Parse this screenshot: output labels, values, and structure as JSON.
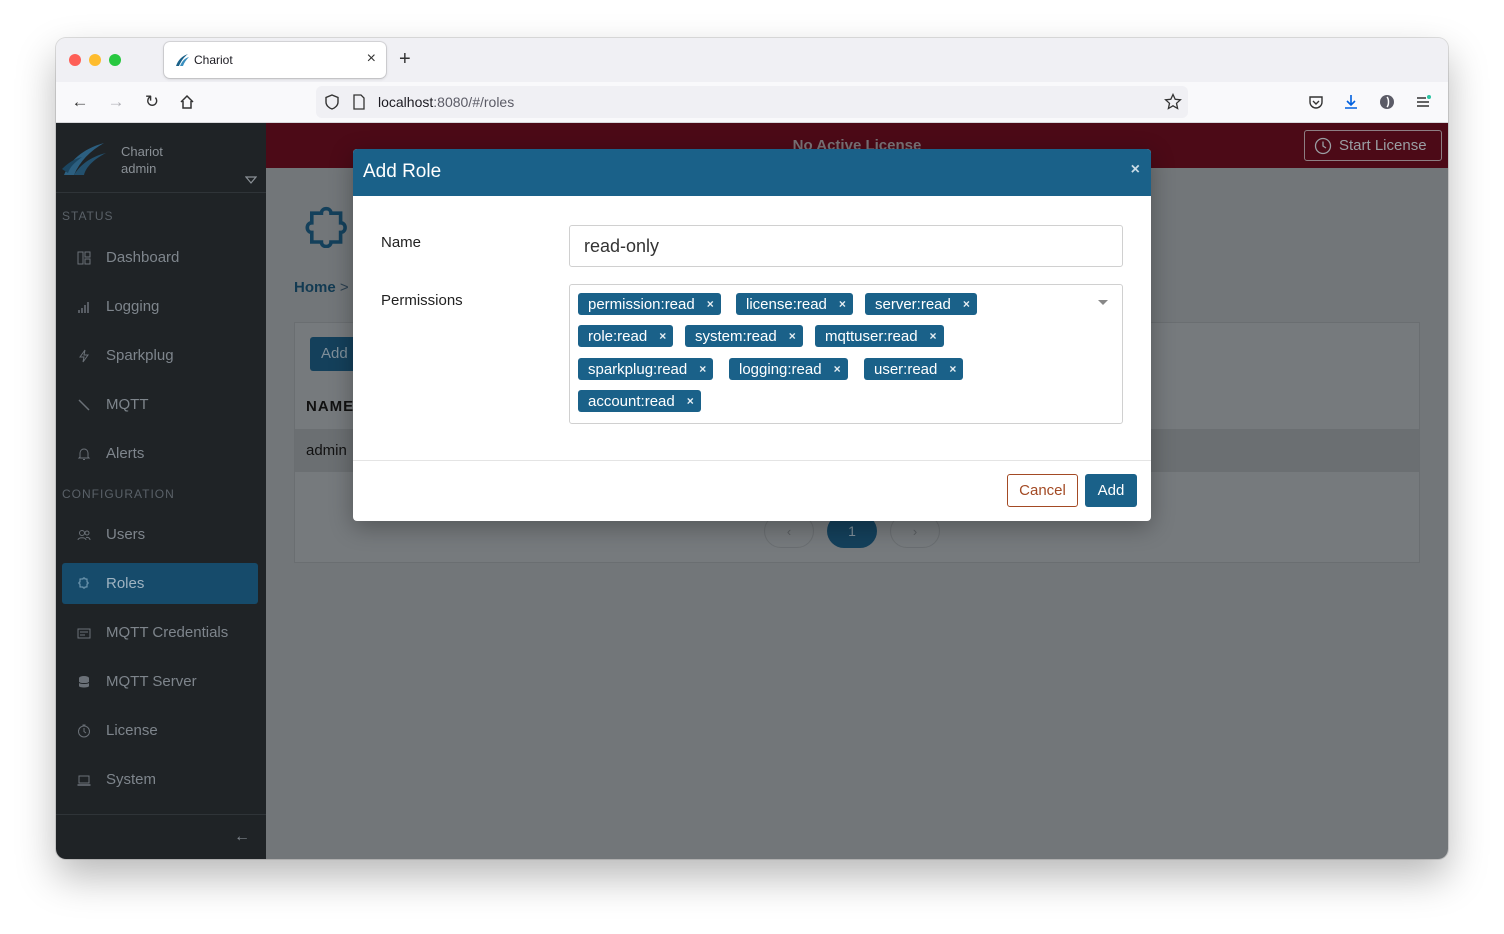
{
  "browser": {
    "tab_title": "Chariot",
    "url_host": "localhost",
    "url_rest": ":8080/#/roles"
  },
  "sidebar": {
    "brand_name": "Chariot",
    "brand_user": "admin",
    "status_label": "STATUS",
    "config_label": "CONFIGURATION",
    "status_items": [
      {
        "label": "Dashboard",
        "icon": "dashboard-icon"
      },
      {
        "label": "Logging",
        "icon": "bar-chart-icon"
      },
      {
        "label": "Sparkplug",
        "icon": "lightning-icon"
      },
      {
        "label": "MQTT",
        "icon": "slash-icon"
      },
      {
        "label": "Alerts",
        "icon": "bell-icon"
      }
    ],
    "config_items": [
      {
        "label": "Users",
        "icon": "users-icon"
      },
      {
        "label": "Roles",
        "icon": "puzzle-icon",
        "active": true
      },
      {
        "label": "MQTT Credentials",
        "icon": "card-icon"
      },
      {
        "label": "MQTT Server",
        "icon": "database-icon"
      },
      {
        "label": "License",
        "icon": "clock-icon"
      },
      {
        "label": "System",
        "icon": "laptop-icon"
      }
    ]
  },
  "license_bar": {
    "text": "No Active License",
    "button": "Start License"
  },
  "page": {
    "breadcrumb_home": "Home",
    "breadcrumb_sep": ">",
    "add_button": "Add",
    "column_name": "NAME",
    "rows": [
      "admin"
    ],
    "pager_prev": "‹",
    "pager_current": "1",
    "pager_next": "›"
  },
  "modal": {
    "title": "Add Role",
    "close": "×",
    "name_label": "Name",
    "name_value": "read-only",
    "permissions_label": "Permissions",
    "permissions": [
      "permission:read",
      "license:read",
      "server:read",
      "role:read",
      "system:read",
      "mqttuser:read",
      "sparkplug:read",
      "logging:read",
      "user:read",
      "account:read"
    ],
    "chip_remove": "×",
    "cancel_label": "Cancel",
    "add_label": "Add"
  },
  "colors": {
    "primary": "#1a6189",
    "license_bar": "#4c0a17",
    "cancel": "#a34a24",
    "sidebar": "#1f2326"
  }
}
